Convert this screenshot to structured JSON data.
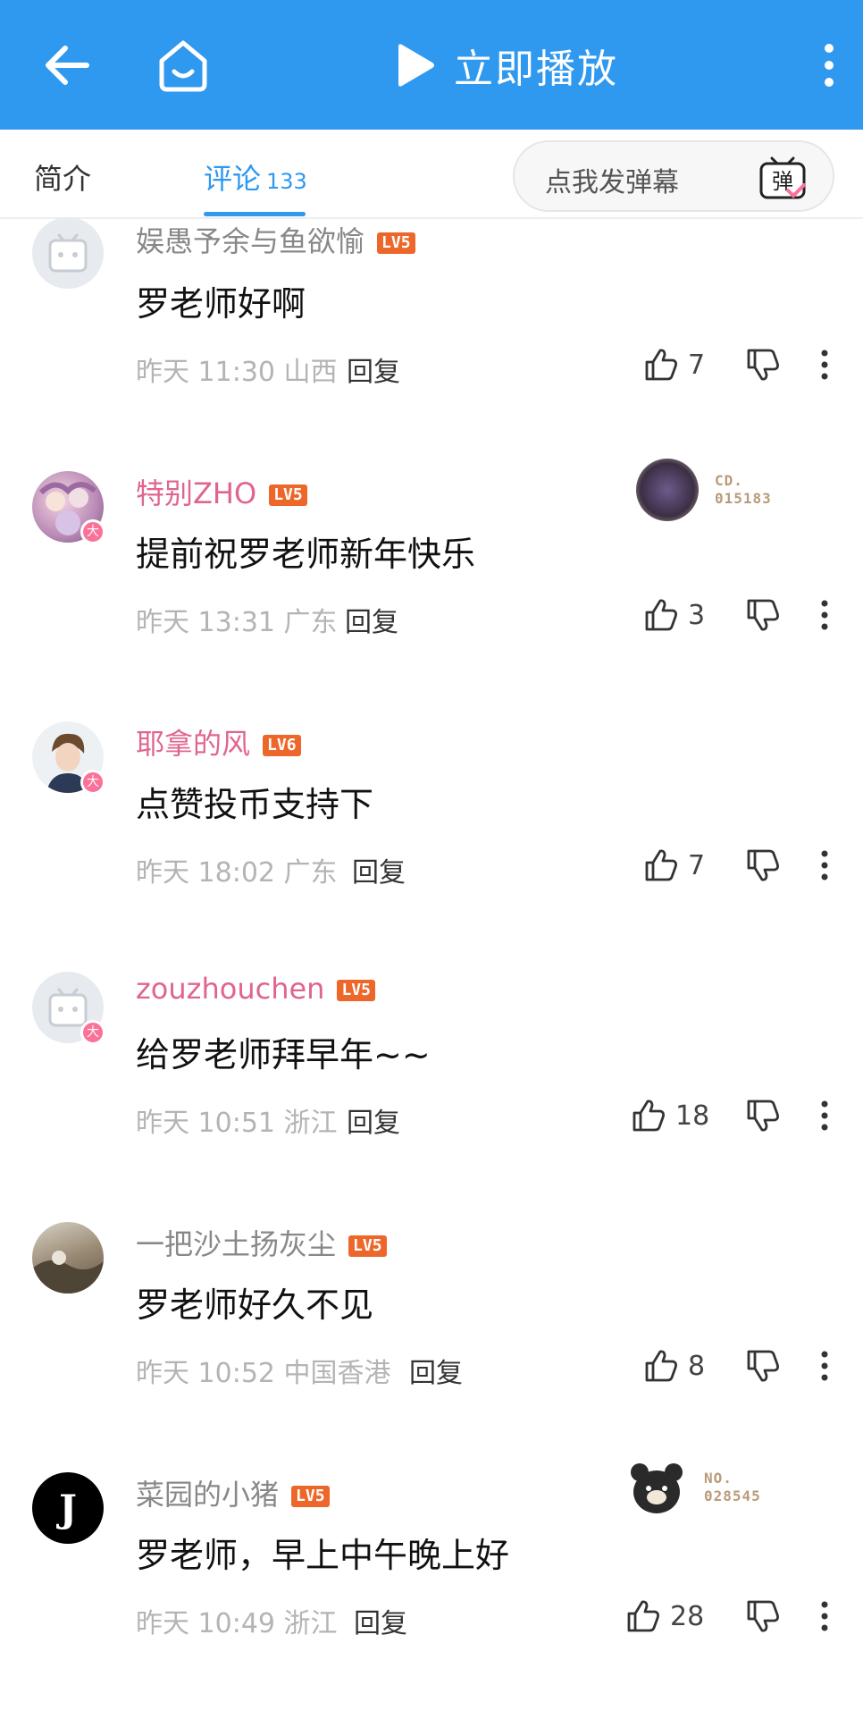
{
  "topbar": {
    "play_label": "立即播放",
    "bg_color": "#2f98ef"
  },
  "tabs": {
    "intro_label": "简介",
    "comments_label": "评论",
    "comments_count": "133",
    "danmaku_placeholder": "点我发弹幕",
    "danmaku_icon_char": "弹"
  },
  "comments": [
    {
      "username": "娱愚予余与鱼欲愉",
      "level": "LV5",
      "content": "罗老师好啊",
      "time": "昨天 11:30",
      "location": "山西",
      "reply_label": "回复",
      "likes": "7",
      "vip": false,
      "name_style": "gray"
    },
    {
      "username": "特别ZHO",
      "level": "LV5",
      "content": "提前祝罗老师新年快乐",
      "time": "昨天 13:31",
      "location": "广东",
      "reply_label": "回复",
      "likes": "3",
      "vip": true,
      "name_style": "pink",
      "fan_badge": "CD.\n015183"
    },
    {
      "username": "耶拿的风",
      "level": "LV6",
      "content": "点赞投币支持下",
      "time": "昨天 18:02",
      "location": "广东",
      "reply_label": "回复",
      "likes": "7",
      "vip": true,
      "name_style": "pink"
    },
    {
      "username": "zouzhouchen",
      "level": "LV5",
      "content": "给罗老师拜早年~~",
      "time": "昨天 10:51",
      "location": "浙江",
      "reply_label": "回复",
      "likes": "18",
      "vip": true,
      "name_style": "pink"
    },
    {
      "username": "一把沙土扬灰尘",
      "level": "LV5",
      "content": "罗老师好久不见",
      "time": "昨天 10:52",
      "location": "中国香港",
      "reply_label": "回复",
      "likes": "8",
      "vip": false,
      "name_style": "gray"
    },
    {
      "username": "菜园的小猪",
      "level": "LV5",
      "content": "罗老师，早上中午晚上好",
      "time": "昨天 10:49",
      "location": "浙江",
      "reply_label": "回复",
      "likes": "28",
      "vip": false,
      "name_style": "gray",
      "fan_badge": "NO.\n028545"
    }
  ],
  "vip_badge_char": "大",
  "avatar_logo_char": "J",
  "colors": {
    "accent": "#2f98ef",
    "pink": "#e0658e",
    "level_badge": "#ee672a"
  }
}
